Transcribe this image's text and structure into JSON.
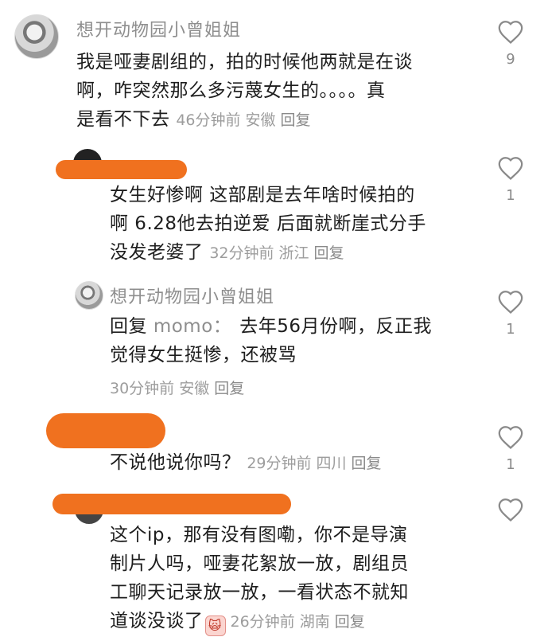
{
  "comments": [
    {
      "username": "想开动物园小曾姐姐",
      "text_lines": [
        "我是哑妻剧组的，拍的时候他两就是在谈",
        "啊，咋突然那么多污蔑女生的。。。。真",
        "是看不下去"
      ],
      "time": "46分钟前",
      "location": "安徽",
      "reply_label": "回复",
      "likes": "9"
    },
    {
      "username": "",
      "text_lines": [
        "女生好惨啊 这部剧是去年啥时候拍的",
        "啊 6.28他去拍逆爱 后面就断崖式分手",
        "没发老婆了"
      ],
      "time": "32分钟前",
      "location": "浙江",
      "reply_label": "回复",
      "likes": "1"
    },
    {
      "username": "想开动物园小曾姐姐",
      "reply_prefix": "回复",
      "reply_to": "momo：",
      "text_lines": [
        "去年56月份啊，反正我",
        "觉得女生挺惨，还被骂"
      ],
      "time": "30分钟前",
      "location": "安徽",
      "reply_label": "回复",
      "likes": "1"
    },
    {
      "username": "",
      "text_lines": [
        "不说他说你吗？"
      ],
      "time": "29分钟前",
      "location": "四川",
      "reply_label": "回复",
      "likes": "1"
    },
    {
      "username": "",
      "text_lines": [
        "这个ip，那有没有图嘞，你不是导演",
        "制片人吗，哑妻花絮放一放，剧组员",
        "工聊天记录放一放，一看状态不就知",
        "道谈没谈了"
      ],
      "emoji": "🙀",
      "time": "26分钟前",
      "location": "湖南",
      "reply_label": "回复",
      "likes": ""
    }
  ],
  "icons": {
    "like": "heart-outline-icon"
  },
  "colors": {
    "redaction": "#f0711f",
    "meta": "#9d9d9d",
    "text": "#1e1e1e"
  }
}
